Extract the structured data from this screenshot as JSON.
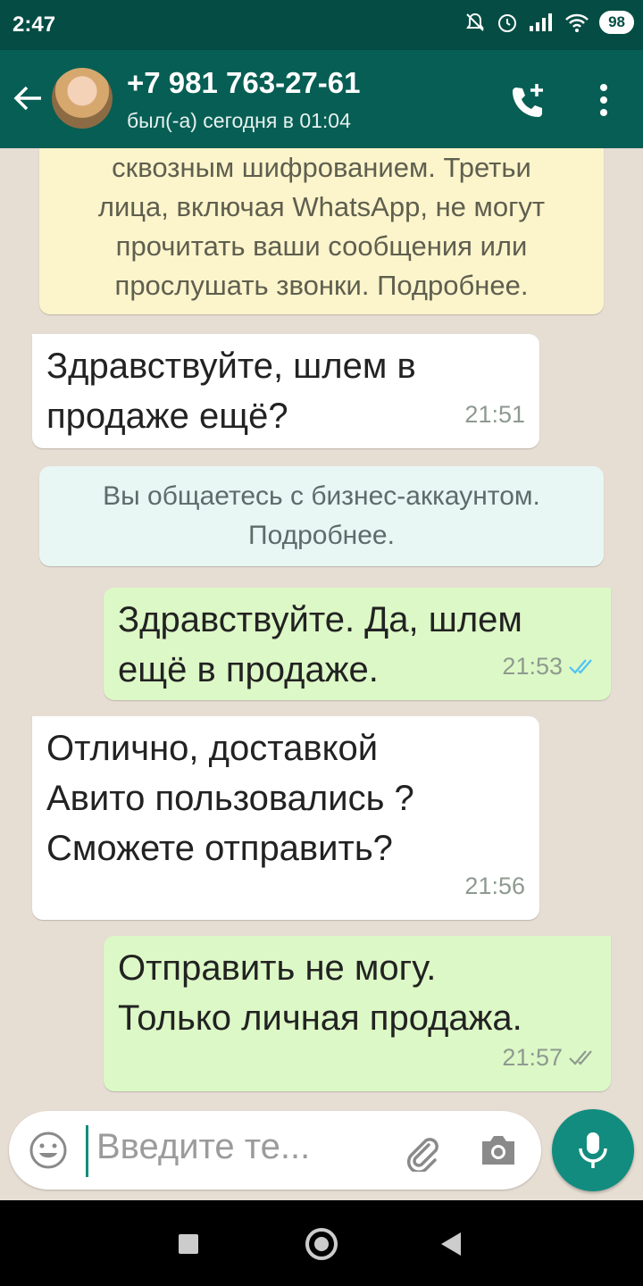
{
  "status_bar": {
    "time": "2:47",
    "battery": "98"
  },
  "header": {
    "contact_name": "+7 981 763-27-61",
    "last_seen": "был(-а) сегодня в 01:04"
  },
  "chat": {
    "encryption_notice": "сквозным шифрованием. Третьи\nлица, включая WhatsApp, не могут\nпрочитать ваши сообщения или\nпрослушать звонки. Подробнее.",
    "business_notice": "Вы общаетесь с бизнес-аккаунтом.\nПодробнее.",
    "messages": [
      {
        "direction": "incoming",
        "text": "Здравствуйте, шлем в\nпродаже ещё?",
        "time": "21:51"
      },
      {
        "direction": "outgoing",
        "text": "Здравствуйте. Да, шлем\nещё в продаже.",
        "time": "21:53",
        "status": "read"
      },
      {
        "direction": "incoming",
        "text": "Отлично, доставкой\nАвито пользовались ?\nСможете отправить?",
        "time": "21:56"
      },
      {
        "direction": "outgoing",
        "text": "Отправить не могу.\nТолько личная продажа.",
        "time": "21:57",
        "status": "delivered"
      }
    ]
  },
  "input": {
    "placeholder": "Введите те..."
  },
  "colors": {
    "header": "#075e54",
    "outgoing_bubble": "#dcf8c6",
    "read_ticks": "#4fc3f7",
    "accent": "#128c7e"
  }
}
